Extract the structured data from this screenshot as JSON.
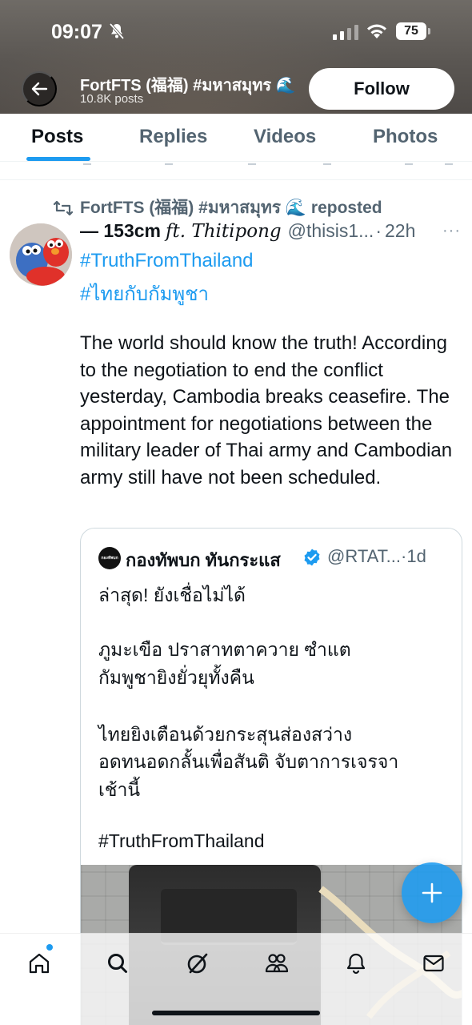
{
  "status_bar": {
    "time": "09:07",
    "battery": "75"
  },
  "header": {
    "profile_name": "FortFTS (福福) #มหาสมุทร 🌊",
    "post_count": "10.8K posts",
    "follow_label": "Follow"
  },
  "tabs": [
    {
      "label": "Posts",
      "active": true
    },
    {
      "label": "Replies"
    },
    {
      "label": "Videos"
    },
    {
      "label": "Photos"
    }
  ],
  "post": {
    "repost_label": "FortFTS (福福) #มหาสมุทร 🌊 reposted",
    "author_name": "— 153cm",
    "author_ft": "𝑓𝑡. 𝑇ℎ𝑖𝑡𝑖𝑝𝑜𝑛𝑔",
    "handle": "@thisis1...",
    "separator": "·",
    "time": "22h",
    "hashtags": [
      "#TruthFromThailand",
      "#ไทยกับกัมพูชา"
    ],
    "body": "The world should know the truth! According to the negotiation to end the conflict yesterday, Cambodia breaks ceasefire. The appointment for negotiations between the military leader of Thai army and Cambodian army still have not been scheduled.",
    "quote": {
      "logo_text": "กองทัพบก",
      "author_name": "กองทัพบก ทันกระแส",
      "handle": "@RTAT...",
      "time": "·1d",
      "lines": [
        "ล่าสุด!  ยังเชื่อไม่ได้",
        "ภูมะเขือ ปราสาทตาควาย ซำแต",
        "กัมพูชายิงยั่วยุทั้งคืน",
        "ไทยยิงเตือนด้วยกระสุนส่องสว่าง",
        "อดทนอดกลั้นเพื่อสันติ จับตาการเจรจา",
        "เช้านี้",
        "#TruthFromThailand"
      ]
    }
  },
  "icons": {
    "back": "arrow-left-icon",
    "repost": "repost-icon",
    "fab": "plus-icon",
    "nav": [
      "home-icon",
      "search-icon",
      "grok-icon",
      "communities-icon",
      "notifications-icon",
      "messages-icon"
    ]
  },
  "colors": {
    "accent": "#1d9bf0",
    "text": "#0f1419",
    "muted": "#536471"
  }
}
